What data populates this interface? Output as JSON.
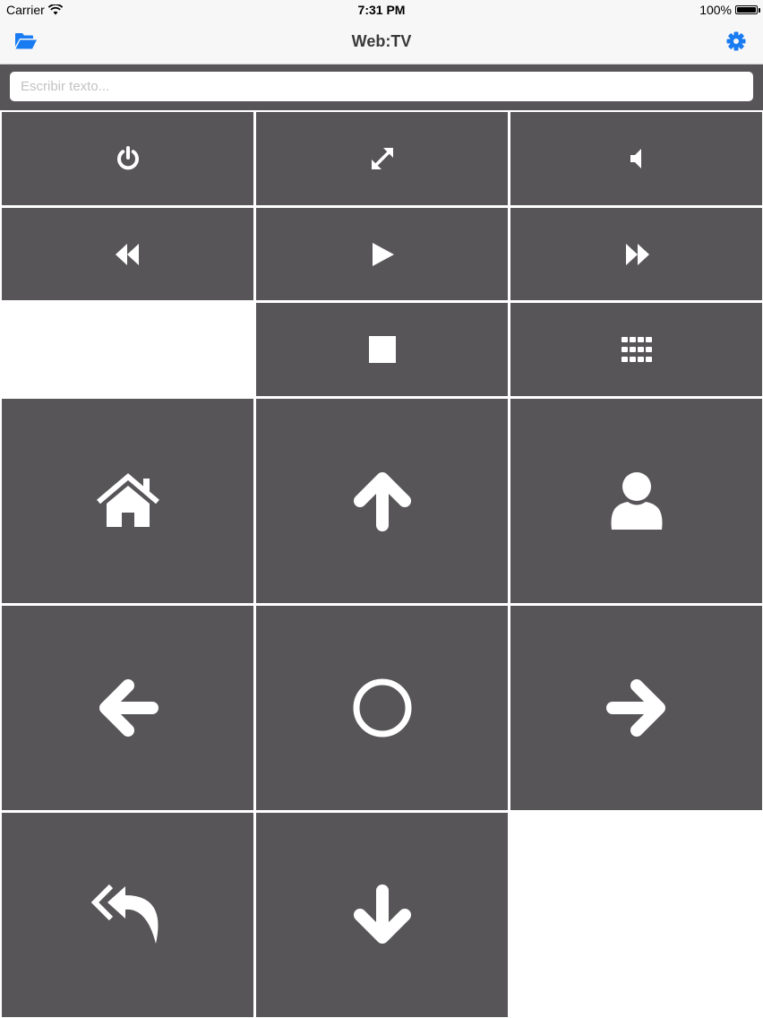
{
  "status_bar": {
    "carrier": "Carrier",
    "time": "7:31 PM",
    "battery": "100%",
    "battery_level": 1.0
  },
  "nav": {
    "title": "Web:TV",
    "left_icon": "folder-open-icon",
    "right_icon": "gear-icon",
    "accent_color": "#1a7cf2"
  },
  "text_input": {
    "placeholder": "Escribir texto...",
    "value": ""
  },
  "remote": {
    "button_color": "#575558",
    "icon_color": "#ffffff",
    "buttons": [
      {
        "name": "power-button",
        "icon": "power-icon"
      },
      {
        "name": "fullscreen-button",
        "icon": "expand-icon"
      },
      {
        "name": "volume-button",
        "icon": "volume-icon"
      },
      {
        "name": "rewind-button",
        "icon": "rewind-icon"
      },
      {
        "name": "play-button",
        "icon": "play-icon"
      },
      {
        "name": "fast-forward-button",
        "icon": "fast-forward-icon"
      },
      {
        "name": "stop-button",
        "icon": "stop-icon"
      },
      {
        "name": "keypad-button",
        "icon": "keypad-icon"
      },
      {
        "name": "home-button",
        "icon": "home-icon"
      },
      {
        "name": "up-button",
        "icon": "arrow-up-icon"
      },
      {
        "name": "user-button",
        "icon": "user-icon"
      },
      {
        "name": "left-button",
        "icon": "arrow-left-icon"
      },
      {
        "name": "ok-button",
        "icon": "circle-icon"
      },
      {
        "name": "right-button",
        "icon": "arrow-right-icon"
      },
      {
        "name": "back-button",
        "icon": "reply-all-icon"
      },
      {
        "name": "down-button",
        "icon": "arrow-down-icon"
      }
    ]
  }
}
